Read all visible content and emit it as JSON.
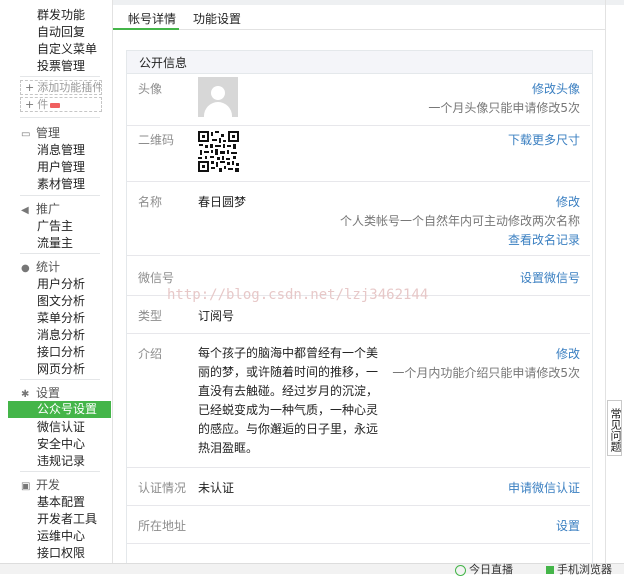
{
  "sidebar": {
    "top_items": [
      "群发功能",
      "自动回复",
      "自定义菜单",
      "投票管理"
    ],
    "add_plugin": "添加功能插件",
    "add_item": "件",
    "groups": [
      {
        "title": "管理",
        "icon": "folder-icon",
        "items": [
          "消息管理",
          "用户管理",
          "素材管理"
        ]
      },
      {
        "title": "推广",
        "icon": "megaphone-icon",
        "items": [
          "广告主",
          "流量主"
        ]
      },
      {
        "title": "统计",
        "icon": "pie-chart-icon",
        "items": [
          "用户分析",
          "图文分析",
          "菜单分析",
          "消息分析",
          "接口分析",
          "网页分析"
        ]
      },
      {
        "title": "设置",
        "icon": "gear-icon",
        "items": [
          "公众号设置",
          "微信认证",
          "安全中心",
          "违规记录"
        ]
      },
      {
        "title": "开发",
        "icon": "code-icon",
        "items": [
          "基本配置",
          "开发者工具",
          "运维中心",
          "接口权限"
        ]
      }
    ],
    "active_item": "公众号设置"
  },
  "tabs": [
    "帐号详情",
    "功能设置"
  ],
  "card": {
    "title": "公开信息",
    "avatar": {
      "label": "头像",
      "link": "修改头像",
      "tip": "一个月头像只能申请修改5次"
    },
    "qrcode": {
      "label": "二维码",
      "link": "下载更多尺寸"
    },
    "name": {
      "label": "名称",
      "value": "春日圆梦",
      "link": "修改",
      "tip": "个人类帐号一个自然年内可主动修改两次名称",
      "link2": "查看改名记录"
    },
    "wechat_id": {
      "label": "微信号",
      "link": "设置微信号"
    },
    "type": {
      "label": "类型",
      "value": "订阅号"
    },
    "intro": {
      "label": "介绍",
      "value": "每个孩子的脑海中都曾经有一个美丽的梦，或许随着时间的推移，一直没有去触碰。经过岁月的沉淀，已经蜕变成为一种气质，一种心灵的感应。与你邂逅的日子里，永远热泪盈眶。",
      "link": "修改",
      "tip": "一个月内功能介绍只能申请修改5次"
    },
    "verify": {
      "label": "认证情况",
      "value": "未认证",
      "link": "申请微信认证"
    },
    "address": {
      "label": "所在地址",
      "link": "设置"
    }
  },
  "watermark": "http://blog.csdn.net/lzj3462144",
  "feedback": "常见问题",
  "bottom_bar": {
    "live": "今日直播",
    "phone": "手机浏览器"
  },
  "colors": {
    "accent_green": "#44b549",
    "link_blue": "#3a7fc1"
  }
}
